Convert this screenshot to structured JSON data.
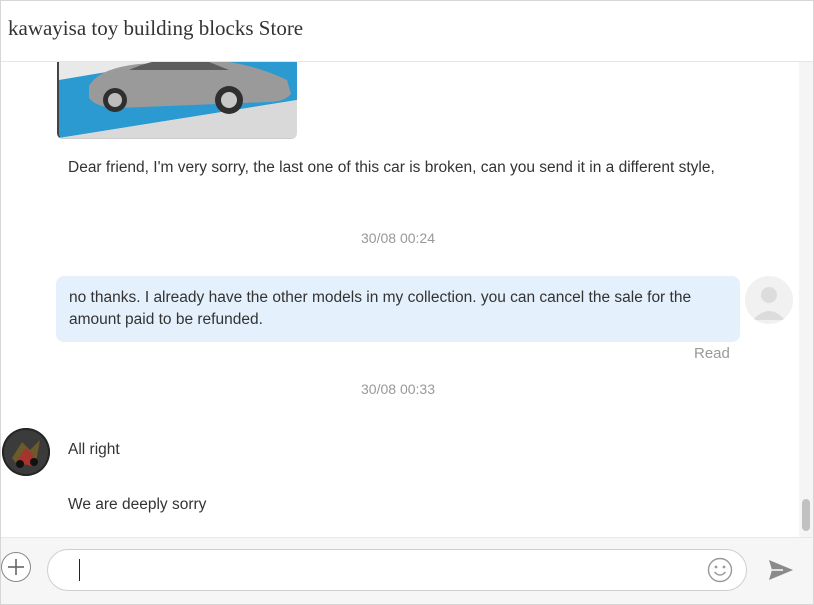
{
  "header": {
    "title": "kawayisa toy building blocks Store"
  },
  "messages": {
    "store_msg_1": "Dear friend, I'm very sorry, the last one of this car is broken, can you send it in a different style,",
    "time_1": "30/08 00:24",
    "user_msg_1": "no thanks. I already have the other models in my collection. you can cancel the sale for the amount paid to be refunded.",
    "read_status": "Read",
    "time_2": "30/08 00:33",
    "store_msg_2": "All right",
    "store_msg_3": "We are deeply sorry"
  },
  "input": {
    "value": "",
    "placeholder": ""
  },
  "icons": {
    "add": "plus-icon",
    "emoji": "smiley-icon",
    "send": "send-icon",
    "user_avatar": "default-user-avatar-icon"
  },
  "colors": {
    "outgoing_bubble": "#e4f0fc",
    "timestamp": "#999999",
    "header_text": "#333333"
  }
}
